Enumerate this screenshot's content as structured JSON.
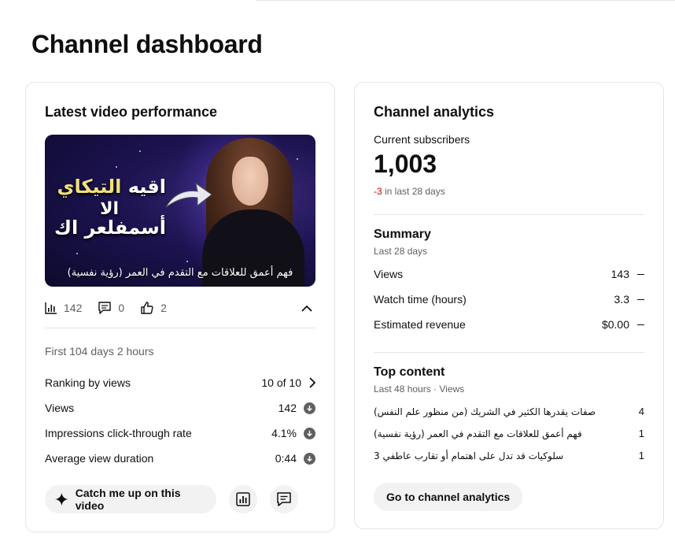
{
  "page": {
    "title": "Channel dashboard"
  },
  "latest_video": {
    "card_title": "Latest video performance",
    "thumbnail": {
      "line1_plain": "اقيه",
      "line1_highlight": "التيكاي",
      "line2": "الا",
      "line3": "أسمفلعر اك",
      "caption": "فهم أعمق للعلاقات مع التقدم في العمر (رؤية نفسية)"
    },
    "stats": {
      "views": "142",
      "comments": "0",
      "likes": "2"
    },
    "first_period": "First 104 days 2 hours",
    "metrics": [
      {
        "label": "Ranking by views",
        "value": "10 of 10"
      },
      {
        "label": "Views",
        "value": "142"
      },
      {
        "label": "Impressions click-through rate",
        "value": "4.1%"
      },
      {
        "label": "Average view duration",
        "value": "0:44"
      }
    ],
    "catch_up_label": "Catch me up on this video"
  },
  "analytics": {
    "card_title": "Channel analytics",
    "subs_label": "Current subscribers",
    "subs_count": "1,003",
    "subs_change": "-3",
    "subs_change_suffix": " in last 28 days",
    "summary": {
      "title": "Summary",
      "period": "Last 28 days",
      "rows": [
        {
          "label": "Views",
          "value": "143"
        },
        {
          "label": "Watch time (hours)",
          "value": "3.3"
        },
        {
          "label": "Estimated revenue",
          "value": "$0.00"
        }
      ]
    },
    "top_content": {
      "title": "Top content",
      "period": "Last 48 hours · Views",
      "rows": [
        {
          "title": "صفات يقدرها الكثير في الشريك (من منظور علم النفس)",
          "value": "4"
        },
        {
          "title": "فهم أعمق للعلاقات مع التقدم في العمر (رؤية نفسية)",
          "value": "1"
        },
        {
          "title": "سلوكيات قد تدل على اهتمام أو تقارب عاطفي 3",
          "value": "1"
        }
      ]
    },
    "go_button": "Go to channel analytics"
  },
  "colors": {
    "negative": "#cc0000",
    "muted": "#606060",
    "pill_bg": "#f2f2f2"
  }
}
